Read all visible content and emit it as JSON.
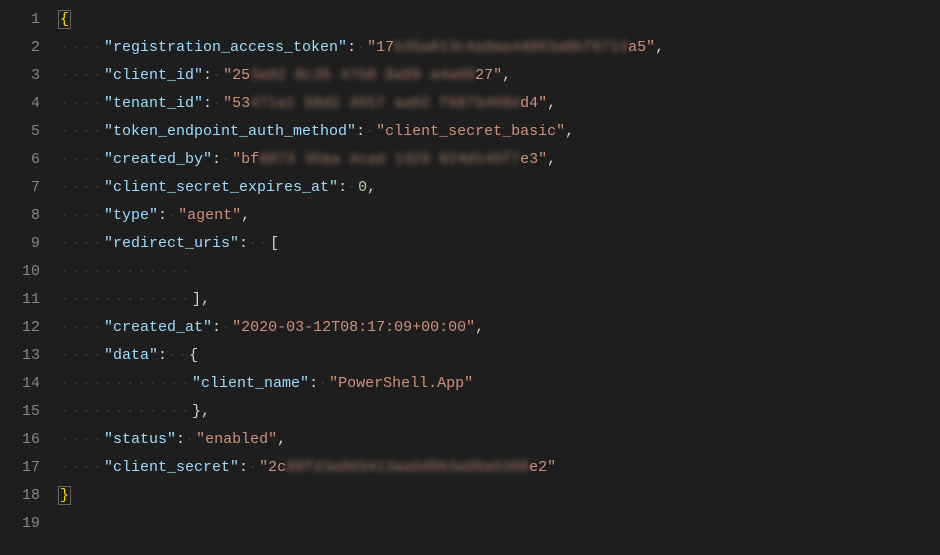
{
  "editor": {
    "lines": [
      {
        "n": 1,
        "indent": 0,
        "open_brace": true,
        "highlight": true
      },
      {
        "n": 2,
        "indent": 1,
        "key": "registration_access_token",
        "val_pre": "17",
        "val_blur": "b35a813c4a9aa44863a8bf8713",
        "val_post": "a5",
        "comma": true
      },
      {
        "n": 3,
        "indent": 1,
        "key": "client_id",
        "val_pre": "25",
        "val_blur": "3a82 8c35 4758 8a89 a4a08",
        "val_post": "27",
        "comma": true
      },
      {
        "n": 4,
        "indent": 1,
        "key": "tenant_id",
        "val_pre": "53",
        "val_blur": "471a1 58d2 4557 aa62 f6879468d",
        "val_post": "d4",
        "comma": true
      },
      {
        "n": 5,
        "indent": 1,
        "key": "token_endpoint_auth_method",
        "val": "client_secret_basic",
        "comma": true
      },
      {
        "n": 6,
        "indent": 1,
        "key": "created_by",
        "val_pre": "bf",
        "val_blur": "8873 35aa 4cad 1329 024d145f7",
        "val_post": "e3",
        "comma": true
      },
      {
        "n": 7,
        "indent": 1,
        "key": "client_secret_expires_at",
        "num_val": "0",
        "comma": true
      },
      {
        "n": 8,
        "indent": 1,
        "key": "type",
        "val": "agent",
        "comma": true
      },
      {
        "n": 9,
        "indent": 1,
        "key": "redirect_uris",
        "open_bracket": true
      },
      {
        "n": 10,
        "indent": 3,
        "blank": true
      },
      {
        "n": 11,
        "indent": 3,
        "close_bracket": true,
        "comma": true
      },
      {
        "n": 12,
        "indent": 1,
        "key": "created_at",
        "val": "2020-03-12T08:17:09+00:00",
        "comma": true
      },
      {
        "n": 13,
        "indent": 1,
        "key": "data",
        "open_obj": true
      },
      {
        "n": 14,
        "indent": 3,
        "key": "client_name",
        "val": "PowerShell.App"
      },
      {
        "n": 15,
        "indent": 3,
        "close_obj": true,
        "comma": true
      },
      {
        "n": 16,
        "indent": 1,
        "key": "status",
        "val": "enabled",
        "comma": true
      },
      {
        "n": 17,
        "indent": 1,
        "key": "client_secret",
        "val_pre": "2c",
        "val_blur": "88fd3a9d3413aa6d863a98a5388",
        "val_post": "e2"
      },
      {
        "n": 18,
        "indent": 0,
        "close_brace": true,
        "highlight": true
      },
      {
        "n": 19,
        "indent": 0,
        "blank": true
      }
    ]
  },
  "colors": {
    "bg": "#1e1e1e",
    "gutter": "#858585",
    "key": "#9cdcfe",
    "string": "#ce9178",
    "number": "#b5cea8",
    "brace": "#ffd700"
  }
}
